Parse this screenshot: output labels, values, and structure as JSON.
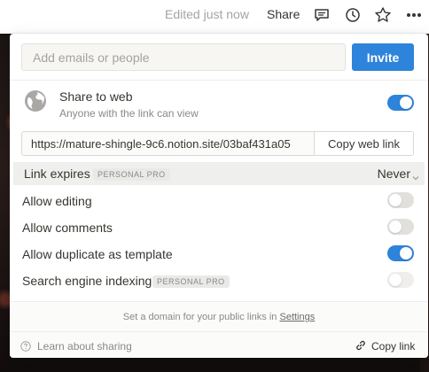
{
  "topbar": {
    "edited": "Edited just now",
    "share": "Share",
    "icons": [
      "comment-icon",
      "history-icon",
      "star-icon",
      "more-icon"
    ]
  },
  "invite": {
    "placeholder": "Add emails or people",
    "button": "Invite"
  },
  "share_to_web": {
    "title": "Share to web",
    "subtitle": "Anyone with the link can view",
    "enabled": true,
    "url": "https://mature-shingle-9c6.notion.site/03baf431a05",
    "copy_label": "Copy web link"
  },
  "link_expires": {
    "label": "Link expires",
    "badge": "PERSONAL PRO",
    "value": "Never"
  },
  "options": [
    {
      "label": "Allow editing",
      "enabled": false
    },
    {
      "label": "Allow comments",
      "enabled": false
    },
    {
      "label": "Allow duplicate as template",
      "enabled": true
    },
    {
      "label": "Search engine indexing",
      "badge": "PERSONAL PRO",
      "enabled": false,
      "disabled": true
    }
  ],
  "domain_note": {
    "text": "Set a domain for your public links in",
    "link": "Settings"
  },
  "footer": {
    "learn": "Learn about sharing",
    "copy_link": "Copy link"
  },
  "colors": {
    "accent": "#2e83db",
    "toggle_off": "#e1e0dd",
    "text": "#37352f",
    "muted": "#8a8985"
  }
}
